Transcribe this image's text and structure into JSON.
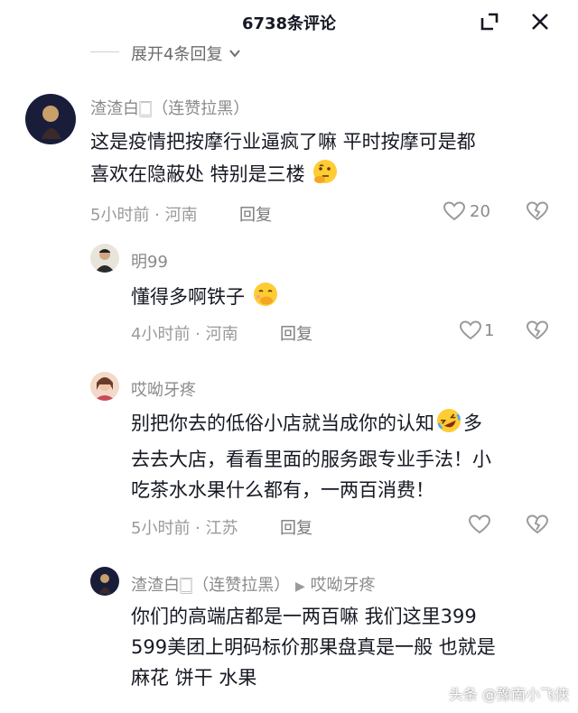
{
  "header": {
    "title": "6738条评论",
    "expand_icon": "collapse-corner-icon",
    "close_icon": "close-icon"
  },
  "expand_replies": "展开4条回复",
  "comments": [
    {
      "author": "渣渣白🀆（连赞拉黑）",
      "text_line1": "这是疫情把按摩行业逼疯了嘛 平时按摩可是都",
      "text_line2": "喜欢在隐蔽处 特别是三楼",
      "meta": "5小时前 · 河南",
      "reply": "回复",
      "likes": "20",
      "emoji": "thinking-face"
    },
    {
      "author": "明99",
      "text_line1": "懂得多啊铁子",
      "meta": "4小时前 · 河南",
      "reply": "回复",
      "likes": "1",
      "emoji": "hand-over-mouth-face"
    },
    {
      "author": "哎呦牙疼",
      "text_line1": "别把你去的低俗小店就当成你的认知",
      "text_line1b": "多",
      "text_line2": "去去大店，看看里面的服务跟专业手法！小",
      "text_line3": "吃茶水水果什么都有，一两百消费！",
      "meta": "5小时前 · 江苏",
      "reply": "回复",
      "emoji": "rolling-laughing-face"
    },
    {
      "author": "渣渣白🀆（连赞拉黑）",
      "reply_to": "哎呦牙疼",
      "text_line1": "你们的高端店都是一两百嘛 我们这里399",
      "text_line2": "599美团上明码标价那果盘真是一般 也就是",
      "text_line3": "麻花 饼干 水果"
    }
  ],
  "watermark": "头条 @豫南小飞侠",
  "colors": {
    "text": "#161823",
    "meta": "#9a9a9a",
    "name": "#8a8a8a"
  }
}
